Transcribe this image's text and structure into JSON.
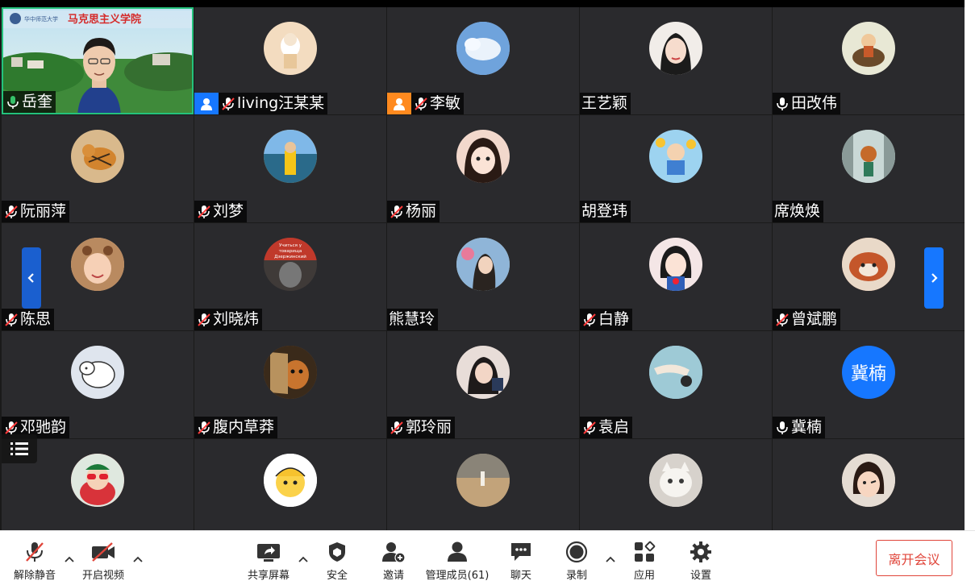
{
  "meeting": {
    "banner_text": "马克思主义学院",
    "active_speaker": "岳奎"
  },
  "participants": [
    {
      "name": "岳奎",
      "mic": "on",
      "type": "video"
    },
    {
      "name": "living汪某某",
      "mic": "muted",
      "type": "avatar",
      "badge": "host-blue",
      "color": "#f3dcc0"
    },
    {
      "name": "李敏",
      "mic": "muted",
      "type": "avatar",
      "badge": "host-orange",
      "color": "#9ec3ea"
    },
    {
      "name": "王艺颖",
      "mic": "none",
      "type": "avatar",
      "color": "#f1ede9"
    },
    {
      "name": "田改伟",
      "mic": "on",
      "type": "avatar",
      "color": "#e8e8d5"
    },
    {
      "name": "阮丽萍",
      "mic": "muted",
      "type": "avatar",
      "color": "#d9b98c"
    },
    {
      "name": "刘梦",
      "mic": "muted",
      "type": "avatar",
      "color": "#e9a846"
    },
    {
      "name": "杨丽",
      "mic": "muted",
      "type": "avatar",
      "color": "#f2d8cc"
    },
    {
      "name": "胡登玮",
      "mic": "none",
      "type": "avatar",
      "color": "#9dd3f0"
    },
    {
      "name": "席焕焕",
      "mic": "none",
      "type": "avatar",
      "color": "#7fa59a"
    },
    {
      "name": "陈思",
      "mic": "muted",
      "type": "avatar",
      "color": "#e5b994"
    },
    {
      "name": "刘晓炜",
      "mic": "muted",
      "type": "avatar",
      "color": "#3f3a38",
      "avatar_text": "Учиться у товарища Дзержинский"
    },
    {
      "name": "熊慧玲",
      "mic": "none",
      "type": "avatar",
      "color": "#b8c5a8"
    },
    {
      "name": "白静",
      "mic": "muted",
      "type": "avatar",
      "color": "#f4e6e6"
    },
    {
      "name": "曾斌鹏",
      "mic": "muted",
      "type": "avatar",
      "color": "#c96b46"
    },
    {
      "name": "邓驰韵",
      "mic": "muted",
      "type": "avatar",
      "color": "#dfe5ee"
    },
    {
      "name": "腹内草莽",
      "mic": "muted",
      "type": "avatar",
      "color": "#8a5a32"
    },
    {
      "name": "郭玲丽",
      "mic": "muted",
      "type": "avatar",
      "color": "#5a4a48"
    },
    {
      "name": "袁启",
      "mic": "muted",
      "type": "avatar",
      "color": "#7fb6c9"
    },
    {
      "name": "冀楠",
      "mic": "on",
      "type": "text-avatar",
      "avatar_text": "冀楠"
    },
    {
      "name": "",
      "mic": "muted",
      "type": "avatar",
      "color": "#d8333a"
    },
    {
      "name": "",
      "mic": "none",
      "type": "avatar",
      "color": "#fbd24a"
    },
    {
      "name": "",
      "mic": "muted",
      "type": "avatar",
      "color": "#a58f6e"
    },
    {
      "name": "",
      "mic": "none",
      "type": "avatar",
      "color": "#e8e6e2"
    },
    {
      "name": "",
      "mic": "muted",
      "type": "avatar",
      "color": "#d7b9a5"
    }
  ],
  "toolbar": {
    "unmute": "解除静音",
    "start_video": "开启视频",
    "share_screen": "共享屏幕",
    "security": "安全",
    "invite": "邀请",
    "manage_members": "管理成员(61)",
    "chat": "聊天",
    "record": "录制",
    "apps": "应用",
    "settings": "设置",
    "leave": "离开会议"
  },
  "colors": {
    "tile_bg": "#2a2a2d",
    "accent": "#1677ff",
    "leave": "#e0453a",
    "active_border": "#24c27c"
  }
}
